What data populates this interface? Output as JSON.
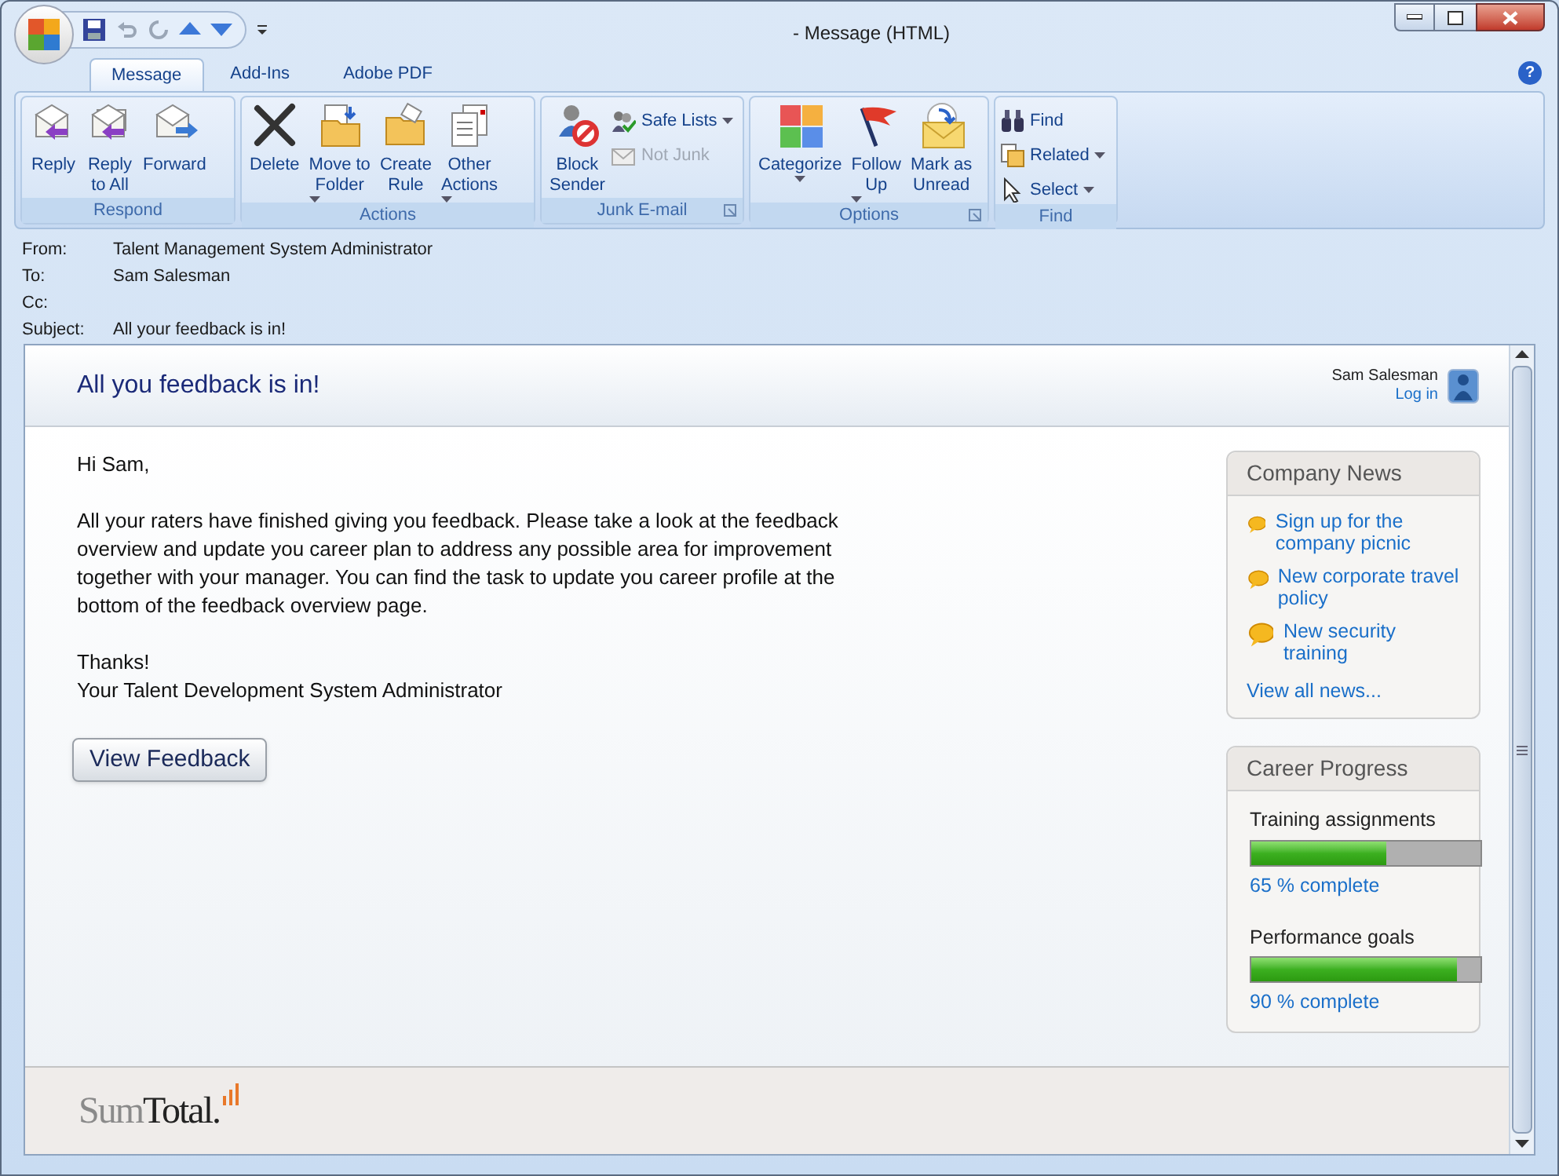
{
  "window": {
    "title": "- Message (HTML)"
  },
  "help_button": "?",
  "tabs": [
    {
      "label": "Message",
      "selected": true
    },
    {
      "label": "Add-Ins",
      "selected": false
    },
    {
      "label": "Adobe PDF",
      "selected": false
    }
  ],
  "ribbon": [
    {
      "label": "Respond",
      "launcher": false,
      "buttons": [
        {
          "kind": "large",
          "label": "Reply",
          "caret": false
        },
        {
          "kind": "large",
          "label": "Reply\nto All",
          "caret": false
        },
        {
          "kind": "large",
          "label": "Forward",
          "caret": false
        }
      ]
    },
    {
      "label": "Actions",
      "launcher": false,
      "buttons": [
        {
          "kind": "large",
          "label": "Delete",
          "caret": false
        },
        {
          "kind": "large",
          "label": "Move to\nFolder",
          "caret": true
        },
        {
          "kind": "large",
          "label": "Create\nRule",
          "caret": false
        },
        {
          "kind": "large",
          "label": "Other\nActions",
          "caret": true
        }
      ]
    },
    {
      "label": "Junk E-mail",
      "launcher": true,
      "buttons": [
        {
          "kind": "large",
          "label": "Block\nSender",
          "caret": false
        },
        {
          "kind": "small",
          "label": "Safe Lists",
          "caret": true,
          "disabled": false
        },
        {
          "kind": "small",
          "label": "Not Junk",
          "caret": false,
          "disabled": true
        }
      ]
    },
    {
      "label": "Options",
      "launcher": true,
      "buttons": [
        {
          "kind": "large",
          "label": "Categorize",
          "caret": true
        },
        {
          "kind": "large",
          "label": "Follow\nUp",
          "caret": true
        },
        {
          "kind": "large",
          "label": "Mark as\nUnread",
          "caret": false
        }
      ]
    },
    {
      "label": "Find",
      "launcher": false,
      "buttons": [
        {
          "kind": "small",
          "label": "Find",
          "caret": false,
          "disabled": false
        },
        {
          "kind": "small",
          "label": "Related",
          "caret": true,
          "disabled": false
        },
        {
          "kind": "small",
          "label": "Select",
          "caret": true,
          "disabled": false
        }
      ]
    }
  ],
  "header_fields": [
    {
      "label": "From:",
      "value": "Talent Management System Administrator"
    },
    {
      "label": "To:",
      "value": "Sam Salesman"
    },
    {
      "label": "Cc:"
    },
    {
      "label": "Subject:",
      "value": "All your feedback is in!"
    }
  ],
  "email": {
    "title": "All you feedback is in!",
    "user": "Sam Salesman",
    "login": "Log in",
    "paragraphs": [
      "Hi Sam,",
      "All your raters have finished giving you feedback. Please take a look at the feedback overview and update you career plan to address any possible area for improvement together with your manager. You can find the task to update you career profile at the bottom of the feedback overview page.",
      "Thanks!\nYour Talent Development System Administrator"
    ],
    "button": "View Feedback",
    "company_news": {
      "title": "Company News",
      "items": [
        "Sign up for the company picnic",
        "New corporate travel policy",
        "New security training"
      ],
      "more": "View all news..."
    },
    "career_progress": {
      "title": "Career Progress",
      "items": [
        {
          "name": "Training assignments",
          "level": 0.59,
          "reading": "65 % complete"
        },
        {
          "name": "Performance goals",
          "level": 0.9,
          "reading": "90 % complete"
        }
      ]
    },
    "logo": [
      "Sum",
      "Total."
    ]
  }
}
